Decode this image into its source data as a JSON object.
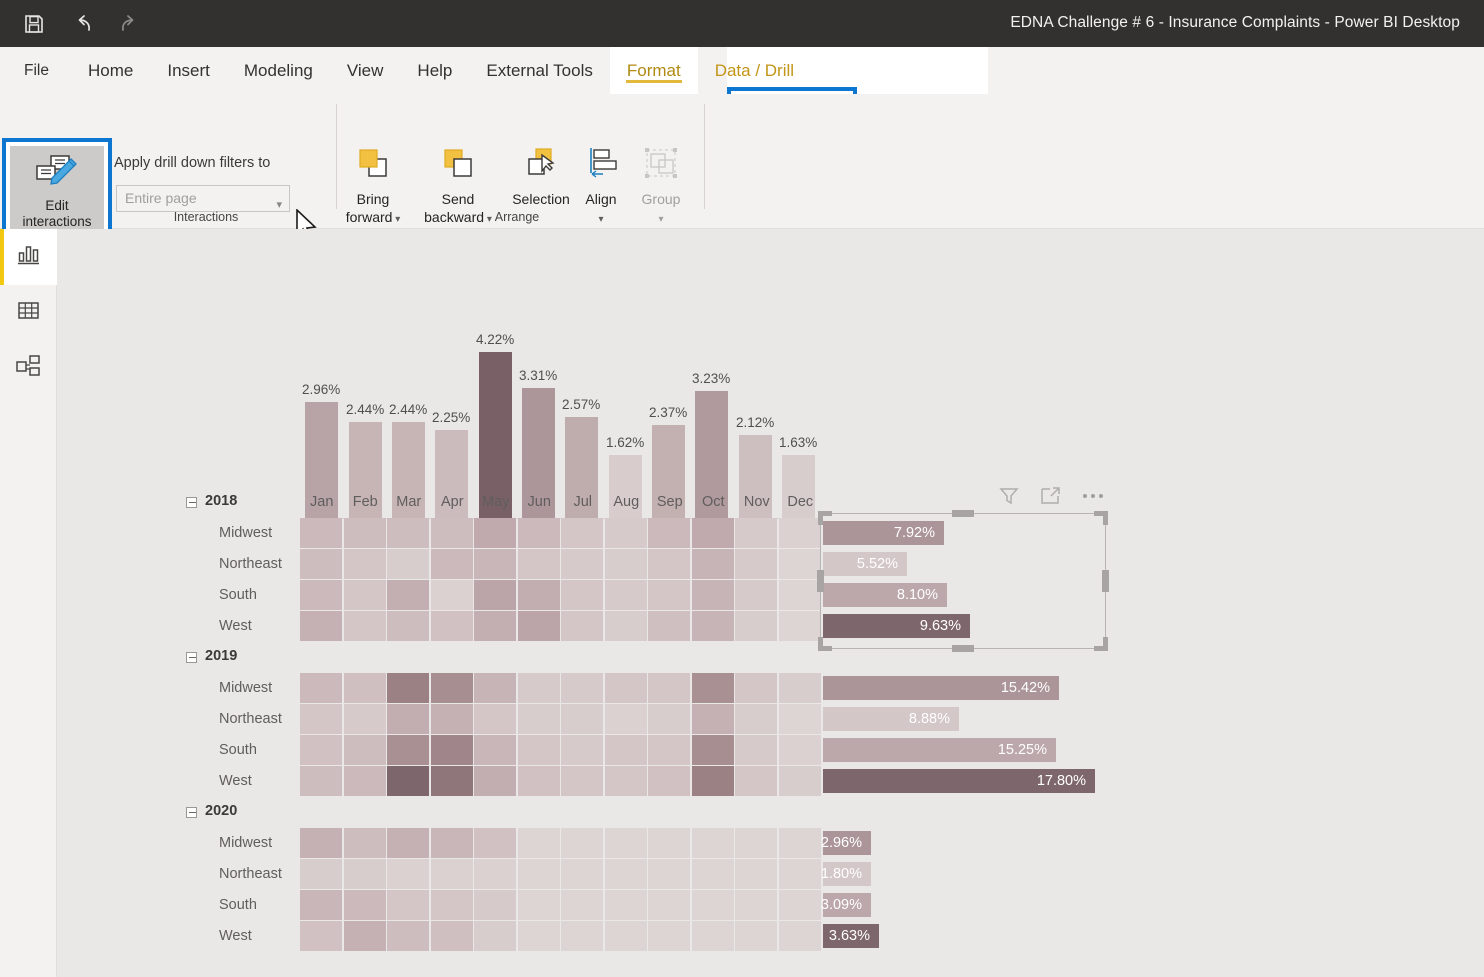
{
  "titlebar": {
    "title": "EDNA Challenge # 6 - Insurance Complaints - Power BI Desktop",
    "quick_access": [
      {
        "name": "save-icon",
        "label": "Save"
      },
      {
        "name": "undo-icon",
        "label": "Undo"
      },
      {
        "name": "redo-icon",
        "label": "Redo"
      }
    ]
  },
  "ribbon": {
    "tabs": [
      {
        "label": "File",
        "kind": "file"
      },
      {
        "label": "Home",
        "kind": "normal"
      },
      {
        "label": "Insert",
        "kind": "normal"
      },
      {
        "label": "Modeling",
        "kind": "normal"
      },
      {
        "label": "View",
        "kind": "normal"
      },
      {
        "label": "Help",
        "kind": "normal"
      },
      {
        "label": "External Tools",
        "kind": "normal"
      },
      {
        "label": "Format",
        "kind": "contextual-active"
      },
      {
        "label": "Data / Drill",
        "kind": "contextual"
      }
    ],
    "active_tab": "Format",
    "highlight_color": "#0d76d0",
    "accent_color": "#e3b93b",
    "groups": [
      {
        "label": "Interactions"
      },
      {
        "label": "Arrange"
      }
    ],
    "interactions_group": {
      "edit_interactions_label_line1": "Edit",
      "edit_interactions_label_line2": "interactions",
      "edit_interactions_state": "selected",
      "drill_filters_label": "Apply drill down filters to",
      "drill_filters_value": "Entire page",
      "drill_filters_placeholder": "Entire page"
    },
    "arrange_group": {
      "buttons": [
        {
          "name": "bring-forward-button",
          "line1": "Bring",
          "line2": "forward",
          "has_chevron": true,
          "disabled": false
        },
        {
          "name": "send-backward-button",
          "line1": "Send",
          "line2": "backward",
          "has_chevron": true,
          "disabled": false
        },
        {
          "name": "selection-button",
          "line1": "Selection",
          "line2": "",
          "has_chevron": false,
          "disabled": false
        },
        {
          "name": "align-button",
          "line1": "Align",
          "line2": "",
          "has_chevron": true,
          "disabled": false
        },
        {
          "name": "group-button",
          "line1": "Group",
          "line2": "",
          "has_chevron": true,
          "disabled": true
        }
      ]
    }
  },
  "left_rail": {
    "items": [
      {
        "name": "sidebar-item-report-view",
        "icon": "bar-chart-icon",
        "label": "Report",
        "selected": true
      },
      {
        "name": "sidebar-item-data-view",
        "icon": "table-icon",
        "label": "Data",
        "selected": false
      },
      {
        "name": "sidebar-item-model-view",
        "icon": "model-relationships-icon",
        "label": "Model",
        "selected": false
      }
    ]
  },
  "canvas": {
    "background": "#eae7e7",
    "visual_header": {
      "filter_label": "Filters",
      "focus_label": "Focus mode",
      "more_label": "More options"
    }
  },
  "chart_data": [
    {
      "type": "bar",
      "name": "monthly-complaints-column-chart",
      "title": "",
      "xlabel": "",
      "ylabel": "",
      "ylim": [
        0,
        4.5
      ],
      "grid": false,
      "legend": null,
      "value_suffix": "%",
      "categories": [
        "Jan",
        "Feb",
        "Mar",
        "Apr",
        "May",
        "Jun",
        "Jul",
        "Aug",
        "Sep",
        "Oct",
        "Nov",
        "Dec"
      ],
      "values": [
        2.96,
        2.44,
        2.44,
        2.25,
        4.22,
        3.31,
        2.57,
        1.62,
        2.37,
        3.23,
        2.12,
        1.63
      ],
      "labels": [
        "2.96%",
        "2.44%",
        "2.44%",
        "2.25%",
        "4.22%",
        "3.31%",
        "2.57%",
        "1.62%",
        "2.37%",
        "3.23%",
        "2.12%",
        "1.63%"
      ],
      "colors": [
        "#b8a4a6",
        "#c7b5b6",
        "#c7b5b6",
        "#cbbbbc",
        "#786066",
        "#ac9699",
        "#bfacad",
        "#d8cccc",
        "#c3b0b1",
        "#b09a9d",
        "#cdbebf",
        "#d8cdcd"
      ]
    },
    {
      "type": "heatmap",
      "name": "region-year-month-matrix",
      "title": "",
      "column_headers": [
        "Jan",
        "Feb",
        "Mar",
        "Apr",
        "May",
        "Jun",
        "Jul",
        "Aug",
        "Sep",
        "Oct",
        "Nov",
        "Dec"
      ],
      "row_groups": [
        {
          "label": "2018",
          "expanded": true,
          "rows": [
            {
              "label": "Midwest",
              "cells": [
                "#cbb9bb",
                "#cdbdbe",
                "#cdbdbe",
                "#cdbdbe",
                "#c0aaad",
                "#cbb9bb",
                "#d4c6c7",
                "#d6cacb",
                "#cbb9bb",
                "#c0aaad",
                "#d6cacb",
                "#dbd1d1"
              ]
            },
            {
              "label": "Northeast",
              "cells": [
                "#cdbdbe",
                "#d4c6c7",
                "#d8cdcd",
                "#cbb9bb",
                "#c9b6b8",
                "#d4c6c7",
                "#d6cacb",
                "#d8cdcd",
                "#d4c6c7",
                "#c7b4b6",
                "#d6cacb",
                "#ddd4d4"
              ]
            },
            {
              "label": "South",
              "cells": [
                "#cbb9bb",
                "#d4c6c7",
                "#c3aeb1",
                "#dbd1d1",
                "#bca5a8",
                "#c2adb0",
                "#d4c6c7",
                "#d6cacb",
                "#d4c6c7",
                "#c7b4b6",
                "#d6cacb",
                "#ddd4d4"
              ]
            },
            {
              "label": "West",
              "cells": [
                "#c5b1b4",
                "#d4c6c7",
                "#cdbdbe",
                "#d1c1c2",
                "#c3aeb1",
                "#bca5a8",
                "#d4c6c7",
                "#d8cdcd",
                "#cfbfc0",
                "#c7b4b6",
                "#d8cdcd",
                "#ddd4d4"
              ]
            }
          ]
        },
        {
          "label": "2019",
          "expanded": true,
          "rows": [
            {
              "label": "Midwest",
              "cells": [
                "#cbb9bb",
                "#cfbfc0",
                "#9b8184",
                "#a68e91",
                "#c7b4b6",
                "#d6cacb",
                "#d6cacb",
                "#d4c6c7",
                "#d4c6c7",
                "#a89093",
                "#d4c6c7",
                "#d8cdcd"
              ]
            },
            {
              "label": "Northeast",
              "cells": [
                "#d4c6c7",
                "#d6cacb",
                "#c2adb0",
                "#c5b1b4",
                "#d4c6c7",
                "#d8cdcd",
                "#d8cdcd",
                "#dbd1d1",
                "#d8cdcd",
                "#c5b1b4",
                "#d8cdcd",
                "#ddd4d4"
              ]
            },
            {
              "label": "South",
              "cells": [
                "#d1c1c2",
                "#cdbdbe",
                "#a89093",
                "#a0868a",
                "#c9b6b8",
                "#d4c6c7",
                "#d6cacb",
                "#d4c6c7",
                "#d4c6c7",
                "#a68e91",
                "#d6cacb",
                "#dbd1d1"
              ]
            },
            {
              "label": "West",
              "cells": [
                "#cdbdbe",
                "#cbb9bb",
                "#7e676c",
                "#8f767a",
                "#c2adb0",
                "#d1c1c2",
                "#d4c6c7",
                "#d4c6c7",
                "#d1c1c2",
                "#9b8184",
                "#d4c6c7",
                "#d8cdcd"
              ]
            }
          ]
        },
        {
          "label": "2020",
          "expanded": true,
          "rows": [
            {
              "label": "Midwest",
              "cells": [
                "#c5b1b4",
                "#cdbdbe",
                "#c5b1b4",
                "#c9b6b8",
                "#d1c1c2",
                "#ddd4d4",
                "#ddd4d4",
                "#ddd4d4",
                "#ddd4d4",
                "#ddd4d4",
                "#ddd4d4",
                "#ddd4d4"
              ]
            },
            {
              "label": "Northeast",
              "cells": [
                "#d8cdcd",
                "#d8cdcd",
                "#dbd1d1",
                "#dbd1d1",
                "#dbd1d1",
                "#ddd4d4",
                "#ddd4d4",
                "#ddd4d4",
                "#ddd4d4",
                "#ddd4d4",
                "#ddd4d4",
                "#ddd4d4"
              ]
            },
            {
              "label": "South",
              "cells": [
                "#c9b6b8",
                "#cbb9bb",
                "#d4c6c7",
                "#d4c6c7",
                "#d6cacb",
                "#ddd4d4",
                "#ddd4d4",
                "#ddd4d4",
                "#ddd4d4",
                "#ddd4d4",
                "#ddd4d4",
                "#ddd4d4"
              ]
            },
            {
              "label": "West",
              "cells": [
                "#d1c1c2",
                "#c5b1b4",
                "#cdbdbe",
                "#cfbfc0",
                "#d8cdcd",
                "#ddd4d4",
                "#ddd4d4",
                "#ddd4d4",
                "#ddd4d4",
                "#ddd4d4",
                "#ddd4d4",
                "#ddd4d4"
              ]
            }
          ]
        }
      ]
    },
    {
      "type": "bar",
      "orientation": "horizontal",
      "name": "region-total-bars-2018",
      "selected": true,
      "group_label": "2018",
      "categories": [
        "Midwest",
        "Northeast",
        "South",
        "West"
      ],
      "values": [
        7.92,
        5.52,
        8.1,
        9.63
      ],
      "labels": [
        "7.92%",
        "5.52%",
        "8.10%",
        "9.63%"
      ],
      "colors": [
        "#ab9599",
        "#d4c7c8",
        "#bca7aa",
        "#7e676c"
      ],
      "xlim": [
        0,
        18.5
      ]
    },
    {
      "type": "bar",
      "orientation": "horizontal",
      "name": "region-total-bars-2019",
      "selected": false,
      "group_label": "2019",
      "categories": [
        "Midwest",
        "Northeast",
        "South",
        "West"
      ],
      "values": [
        15.42,
        8.88,
        15.25,
        17.8
      ],
      "labels": [
        "15.42%",
        "8.88%",
        "15.25%",
        "17.80%"
      ],
      "colors": [
        "#ab9599",
        "#d4c7c8",
        "#bca7aa",
        "#7e676c"
      ],
      "xlim": [
        0,
        18.5
      ]
    },
    {
      "type": "bar",
      "orientation": "horizontal",
      "name": "region-total-bars-2020",
      "selected": false,
      "group_label": "2020",
      "categories": [
        "Midwest",
        "Northeast",
        "South",
        "West"
      ],
      "values": [
        2.96,
        1.8,
        3.09,
        3.63
      ],
      "labels": [
        "2.96%",
        "1.80%",
        "3.09%",
        "3.63%"
      ],
      "colors": [
        "#ab9599",
        "#d4c7c8",
        "#bca7aa",
        "#7e676c"
      ],
      "xlim": [
        0,
        18.5
      ]
    }
  ]
}
